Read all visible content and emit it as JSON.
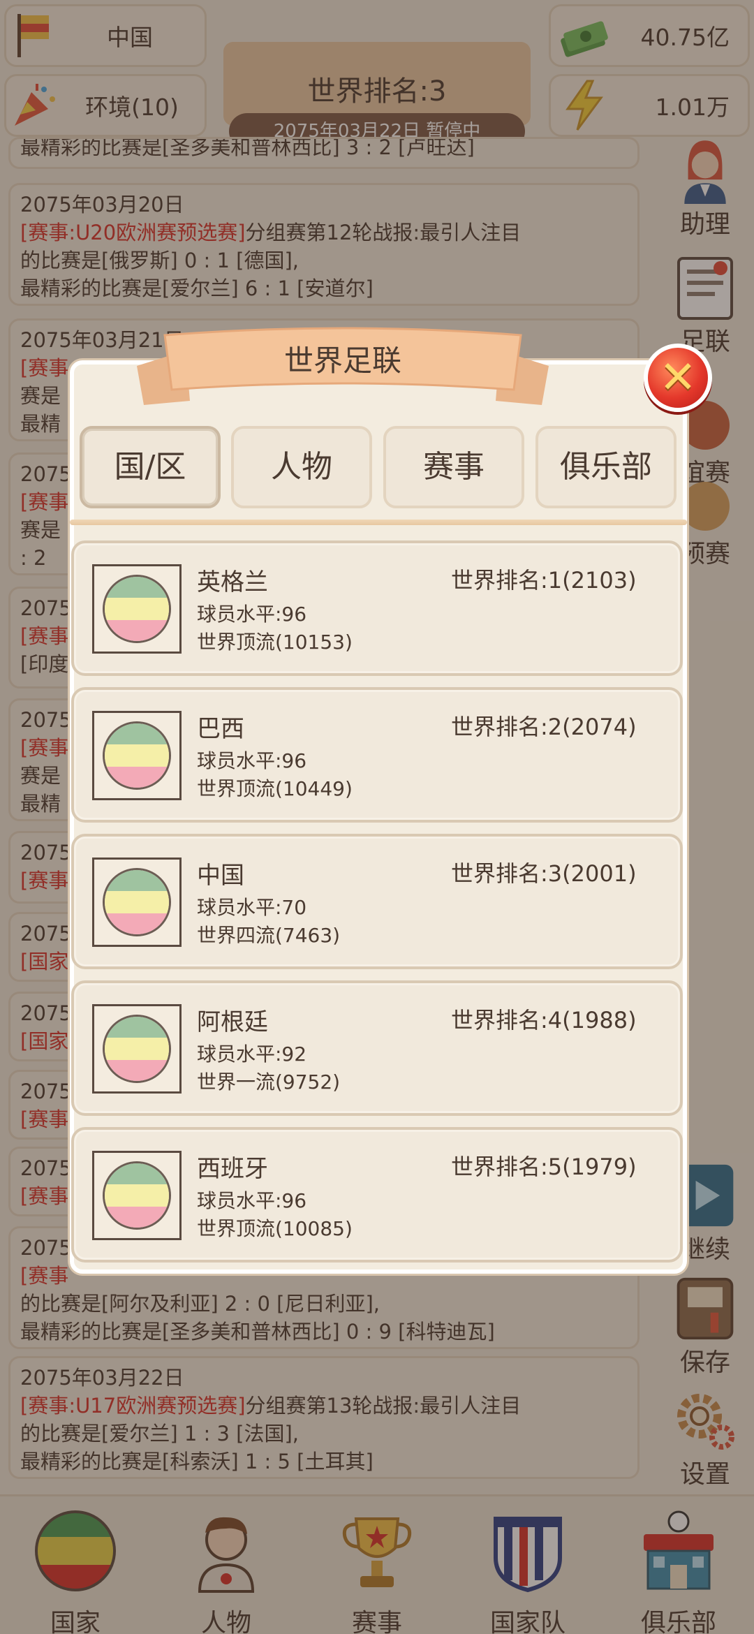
{
  "hud": {
    "country": "中国",
    "environment": "环境(10)",
    "money": "40.75亿",
    "energy": "1.01万",
    "rank_title": "世界排名:3",
    "date_status": "2075年03月22日  暂停中"
  },
  "news": [
    {
      "date": "",
      "tag": "",
      "line1": "",
      "line2": "",
      "line3": "最精彩的比赛是[圣多美和普林西比] 3 : 2 [卢旺达]"
    },
    {
      "date": "2075年03月20日",
      "tag": "[赛事:U20欧洲赛预选赛]",
      "line1": "分组赛第12轮战报:最引人注目",
      "line2": "的比赛是[俄罗斯] 0 : 1 [德国],",
      "line3": "最精彩的比赛是[爱尔兰] 6 : 1 [安道尔]"
    },
    {
      "date": "2075年03月21日",
      "tag": "[赛事",
      "line1": "",
      "line2": "赛是",
      "line3": "最精"
    },
    {
      "date": "2075",
      "tag": "[赛事",
      "line1": "",
      "line2": "赛是",
      "line3": ": 2"
    },
    {
      "date": "2075",
      "tag": "[赛事",
      "line1": "",
      "line2": "[印度",
      "line3": ""
    },
    {
      "date": "2075",
      "tag": "[赛事",
      "line1": "",
      "line2": "赛是",
      "line3": "最精"
    },
    {
      "date": "2075",
      "tag": "[赛事",
      "line1": "",
      "line2": "",
      "line3": ""
    },
    {
      "date": "2075",
      "tag": "[国家",
      "line1": "",
      "line2": "",
      "line3": ""
    },
    {
      "date": "2075",
      "tag": "[国家",
      "line1": "",
      "line2": "",
      "line3": ""
    },
    {
      "date": "2075",
      "tag": "[赛事",
      "line1": "",
      "line2": "",
      "line3": ""
    },
    {
      "date": "2075",
      "tag": "[赛事",
      "line1": "",
      "line2": "",
      "line3": ""
    },
    {
      "date": "2075",
      "tag": "[赛事",
      "line1": "",
      "line2": "的比赛是[阿尔及利亚] 2 : 0 [尼日利亚],",
      "line3": "最精彩的比赛是[圣多美和普林西比] 0 : 9 [科特迪瓦]"
    },
    {
      "date": "2075年03月22日",
      "tag": "[赛事:U17欧洲赛预选赛]",
      "line1": "分组赛第13轮战报:最引人注目",
      "line2": "的比赛是[爱尔兰] 1 : 3 [法国],",
      "line3": "最精彩的比赛是[科索沃] 1 : 5 [土耳其]"
    }
  ],
  "side": {
    "assistant": "助理",
    "football_assoc": "足联",
    "friendly": "谊赛",
    "qualifier": "预赛",
    "continue": "继续",
    "save": "保存",
    "settings": "设置"
  },
  "nav": [
    "国家",
    "人物",
    "赛事",
    "国家队",
    "俱乐部"
  ],
  "dialog": {
    "title": "世界足联",
    "tabs": [
      "国/区",
      "人物",
      "赛事",
      "俱乐部"
    ],
    "active_tab": 0,
    "countries": [
      {
        "name": "英格兰",
        "rank": "世界排名:1(2103)",
        "level": "球员水平:96",
        "tier": "世界顶流(10153)"
      },
      {
        "name": "巴西",
        "rank": "世界排名:2(2074)",
        "level": "球员水平:96",
        "tier": "世界顶流(10449)"
      },
      {
        "name": "中国",
        "rank": "世界排名:3(2001)",
        "level": "球员水平:70",
        "tier": "世界四流(7463)"
      },
      {
        "name": "阿根廷",
        "rank": "世界排名:4(1988)",
        "level": "球员水平:92",
        "tier": "世界一流(9752)"
      },
      {
        "name": "西班牙",
        "rank": "世界排名:5(1979)",
        "level": "球员水平:96",
        "tier": "世界顶流(10085)"
      }
    ]
  },
  "colors": {
    "accent_red": "#d8302a",
    "flag_green": "#9fc3a0",
    "flag_yellow": "#f5efa8",
    "flag_pink": "#f3aab7"
  }
}
